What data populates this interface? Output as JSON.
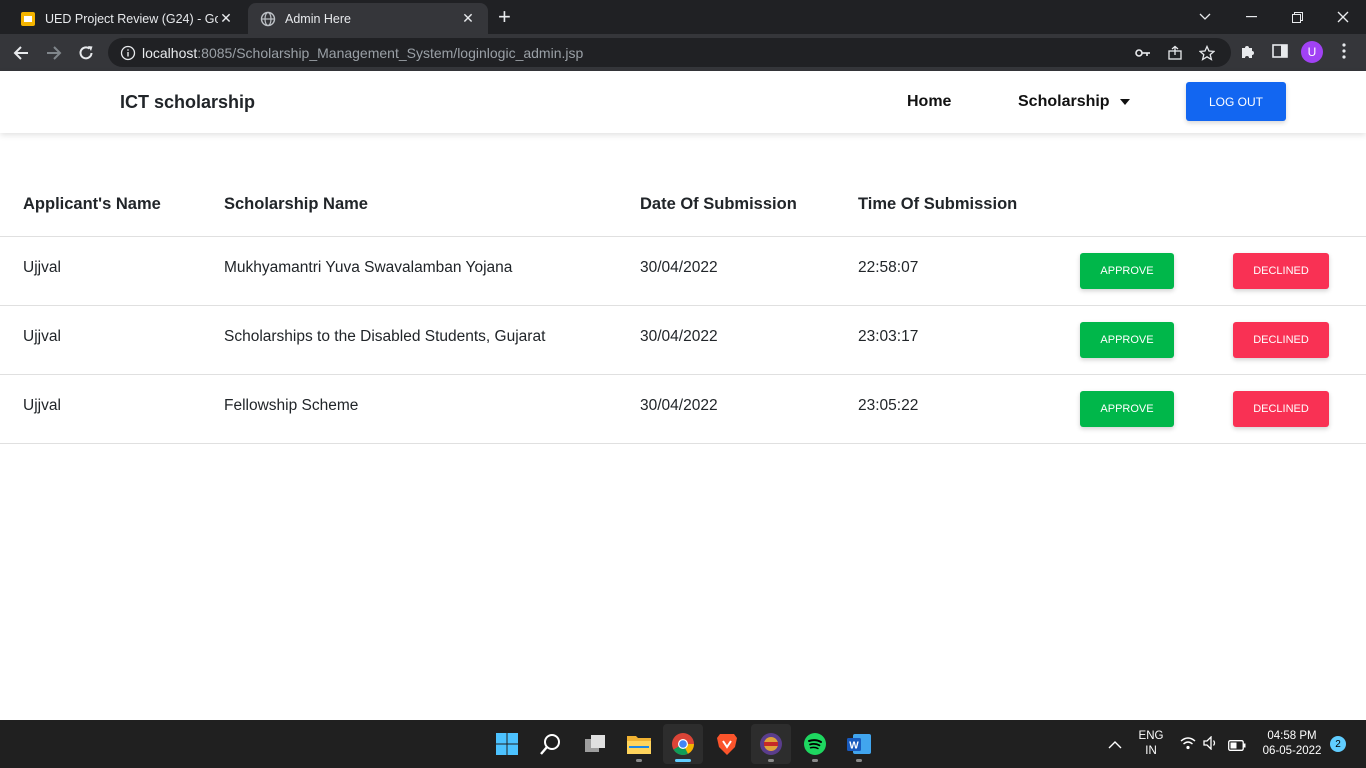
{
  "browser": {
    "tabs": [
      {
        "title": "UED Project Review (G24) - Goog",
        "favicon": "google-slides-icon",
        "active": false
      },
      {
        "title": "Admin Here",
        "favicon": "globe-icon",
        "active": true
      }
    ],
    "url_host": "localhost",
    "url_rest": ":8085/Scholarship_Management_System/loginlogic_admin.jsp",
    "profile_initial": "U"
  },
  "navbar": {
    "brand": "ICT scholarship",
    "home_label": "Home",
    "scholarship_label": "Scholarship",
    "logout_label": "LOG OUT"
  },
  "table": {
    "headers": [
      "Applicant's Name",
      "Scholarship Name",
      "Date Of Submission",
      "Time Of Submission"
    ],
    "rows": [
      {
        "name": "Ujjval",
        "scholarship": "Mukhyamantri Yuva Swavalamban Yojana",
        "date": "30/04/2022",
        "time": "22:58:07",
        "approve": "APPROVE",
        "decline": "DECLINED"
      },
      {
        "name": "Ujjval",
        "scholarship": "Scholarships to the Disabled Students, Gujarat",
        "date": "30/04/2022",
        "time": "23:03:17",
        "approve": "APPROVE",
        "decline": "DECLINED"
      },
      {
        "name": "Ujjval",
        "scholarship": "Fellowship Scheme",
        "date": "30/04/2022",
        "time": "23:05:22",
        "approve": "APPROVE",
        "decline": "DECLINED"
      }
    ]
  },
  "taskbar": {
    "lang_line1": "ENG",
    "lang_line2": "IN",
    "time": "04:58 PM",
    "date": "06-05-2022",
    "notification_count": "2"
  },
  "colors": {
    "primary": "#1266f1",
    "success": "#00b74a",
    "danger": "#f93154",
    "chrome_dark": "#202124",
    "chrome_toolbar": "#35363a"
  }
}
